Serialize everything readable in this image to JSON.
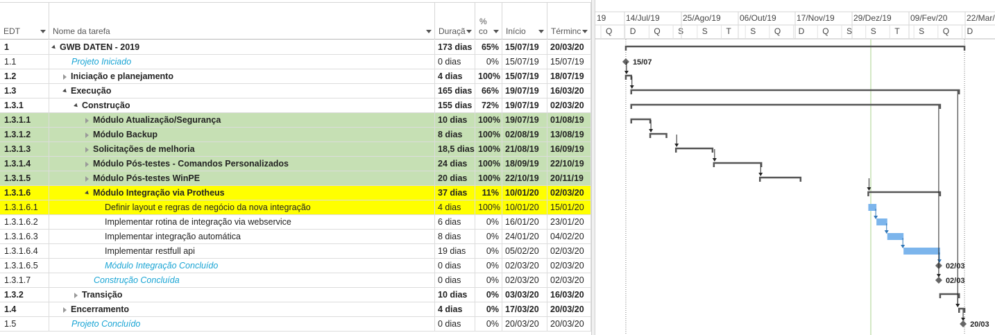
{
  "columns": {
    "edt": "EDT",
    "name": "Nome da tarefa",
    "duration": "Duraçã",
    "pct_top": "%",
    "pct_bottom": "co",
    "start": "Início",
    "end": "Términc"
  },
  "tasks": [
    {
      "edt": "1",
      "name": "GWB DATEN - 2019",
      "duration": "173 dias",
      "pct": "65%",
      "start": "15/07/19",
      "end": "20/03/20",
      "level": 0,
      "summary": true,
      "expanded": true,
      "style": ""
    },
    {
      "edt": "1.1",
      "name": "Projeto Iniciado",
      "duration": "0 dias",
      "pct": "0%",
      "start": "15/07/19",
      "end": "15/07/19",
      "level": 1,
      "milestone": true,
      "style": ""
    },
    {
      "edt": "1.2",
      "name": "Iniciação e planejamento",
      "duration": "4 dias",
      "pct": "100%",
      "start": "15/07/19",
      "end": "18/07/19",
      "level": 1,
      "summary": true,
      "expanded": false,
      "style": ""
    },
    {
      "edt": "1.3",
      "name": "Execução",
      "duration": "165 dias",
      "pct": "66%",
      "start": "19/07/19",
      "end": "16/03/20",
      "level": 1,
      "summary": true,
      "expanded": true,
      "style": ""
    },
    {
      "edt": "1.3.1",
      "name": "Construção",
      "duration": "155 dias",
      "pct": "72%",
      "start": "19/07/19",
      "end": "02/03/20",
      "level": 2,
      "summary": true,
      "expanded": true,
      "style": ""
    },
    {
      "edt": "1.3.1.1",
      "name": "Módulo Atualização/Segurança",
      "duration": "10 dias",
      "pct": "100%",
      "start": "19/07/19",
      "end": "01/08/19",
      "level": 3,
      "summary": true,
      "expanded": false,
      "style": "green"
    },
    {
      "edt": "1.3.1.2",
      "name": "Módulo Backup",
      "duration": "8 dias",
      "pct": "100%",
      "start": "02/08/19",
      "end": "13/08/19",
      "level": 3,
      "summary": true,
      "expanded": false,
      "style": "green"
    },
    {
      "edt": "1.3.1.3",
      "name": "Solicitações de melhoria",
      "duration": "18,5 dias",
      "pct": "100%",
      "start": "21/08/19",
      "end": "16/09/19",
      "level": 3,
      "summary": true,
      "expanded": false,
      "style": "green"
    },
    {
      "edt": "1.3.1.4",
      "name": "Módulo Pós-testes - Comandos Personalizados",
      "duration": "24 dias",
      "pct": "100%",
      "start": "18/09/19",
      "end": "22/10/19",
      "level": 3,
      "summary": true,
      "expanded": false,
      "style": "green"
    },
    {
      "edt": "1.3.1.5",
      "name": "Módulo Pós-testes WinPE",
      "duration": "20 dias",
      "pct": "100%",
      "start": "22/10/19",
      "end": "20/11/19",
      "level": 3,
      "summary": true,
      "expanded": false,
      "style": "green"
    },
    {
      "edt": "1.3.1.6",
      "name": "Módulo Integração via Protheus",
      "duration": "37 dias",
      "pct": "11%",
      "start": "10/01/20",
      "end": "02/03/20",
      "level": 3,
      "summary": true,
      "expanded": true,
      "style": "yellow"
    },
    {
      "edt": "1.3.1.6.1",
      "name": "Definir layout e regras de negócio da nova integração",
      "duration": "4 dias",
      "pct": "100%",
      "start": "10/01/20",
      "end": "15/01/20",
      "level": 4,
      "style": "yellow"
    },
    {
      "edt": "1.3.1.6.2",
      "name": "Implementar rotina de integração via webservice",
      "duration": "6 dias",
      "pct": "0%",
      "start": "16/01/20",
      "end": "23/01/20",
      "level": 4,
      "style": ""
    },
    {
      "edt": "1.3.1.6.3",
      "name": "Implementar integração automática",
      "duration": "8 dias",
      "pct": "0%",
      "start": "24/01/20",
      "end": "04/02/20",
      "level": 4,
      "style": ""
    },
    {
      "edt": "1.3.1.6.4",
      "name": "Implementar restfull api",
      "duration": "19 dias",
      "pct": "0%",
      "start": "05/02/20",
      "end": "02/03/20",
      "level": 4,
      "style": ""
    },
    {
      "edt": "1.3.1.6.5",
      "name": "Módulo Integração Concluído",
      "duration": "0 dias",
      "pct": "0%",
      "start": "02/03/20",
      "end": "02/03/20",
      "level": 4,
      "milestone": true,
      "style": ""
    },
    {
      "edt": "1.3.1.7",
      "name": "Construção Concluída",
      "duration": "0 dias",
      "pct": "0%",
      "start": "02/03/20",
      "end": "02/03/20",
      "level": 3,
      "milestone": true,
      "style": ""
    },
    {
      "edt": "1.3.2",
      "name": "Transição",
      "duration": "10 dias",
      "pct": "0%",
      "start": "03/03/20",
      "end": "16/03/20",
      "level": 2,
      "summary": true,
      "expanded": false,
      "style": ""
    },
    {
      "edt": "1.4",
      "name": "Encerramento",
      "duration": "4 dias",
      "pct": "0%",
      "start": "17/03/20",
      "end": "20/03/20",
      "level": 1,
      "summary": true,
      "expanded": false,
      "style": ""
    },
    {
      "edt": "1.5",
      "name": "Projeto Concluído",
      "duration": "0 dias",
      "pct": "0%",
      "start": "20/03/20",
      "end": "20/03/20",
      "level": 1,
      "milestone": true,
      "style": ""
    }
  ],
  "timeline": {
    "top_labels": [
      "19",
      "14/Jul/19",
      "25/Ago/19",
      "06/Out/19",
      "17/Nov/19",
      "29/Dez/19",
      "09/Fev/20",
      "22/Mar/"
    ],
    "bottom_labels": [
      "Q",
      "D",
      "Q",
      "S",
      "S",
      "T",
      "S",
      "Q",
      "D",
      "Q",
      "S",
      "S",
      "T",
      "S",
      "Q",
      "D"
    ]
  },
  "milestone_labels": {
    "start": "15/07",
    "integration_done": "02/03",
    "construction_done": "02/03",
    "project_done": "20/03"
  },
  "colors": {
    "green_row": "#c6e0b4",
    "yellow_row": "#ffff00",
    "milestone_text": "#18a4d4",
    "task_bar": "#7cb5ec",
    "summary_bar": "#555555",
    "today_line": "#a8d08d"
  }
}
